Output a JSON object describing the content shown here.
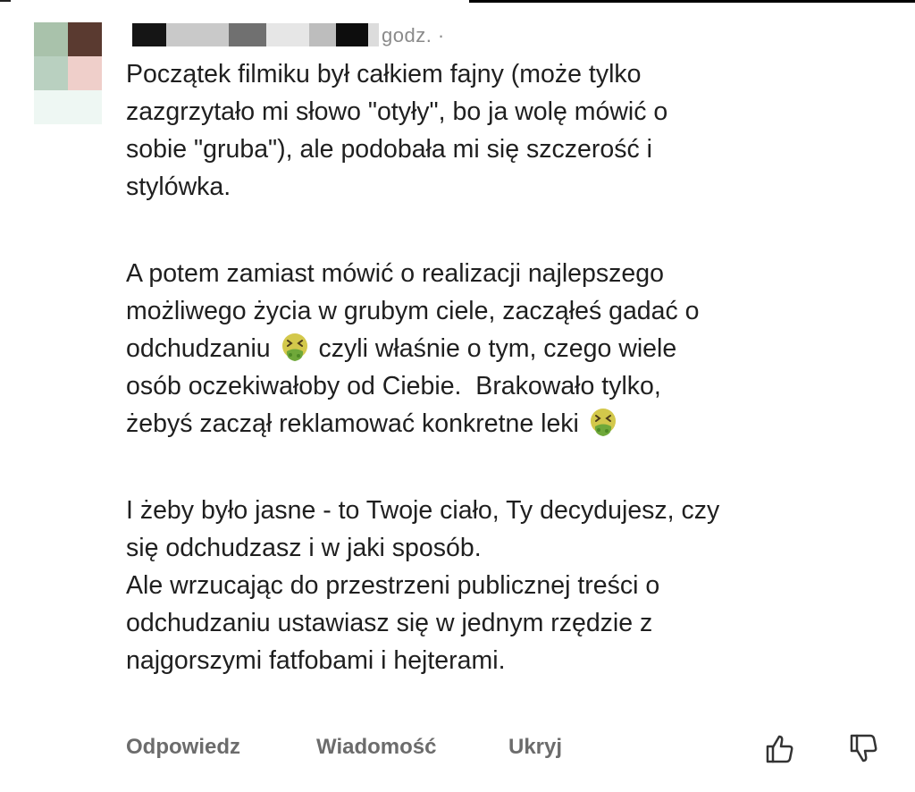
{
  "comment": {
    "time_text": "godz. ·",
    "paragraphs": [
      {
        "lines": [
          "Początek filmiku był całkiem fajny (może tylko",
          "zazgrzytało mi słowo \"otyły\", bo ja wolę mówić o",
          "sobie \"gruba\"), ale podobała mi się szczerość i",
          "stylówka."
        ]
      },
      {
        "line1": "A potem zamiast mówić o realizacji najlepszego",
        "line2": "możliwego życia w grubym ciele, zacząłeś gadać o",
        "line3a": "odchudzaniu ",
        "line3b": " czyli właśnie o tym, czego wiele",
        "line4": "osób oczekiwałoby od Ciebie.  Brakowało tylko,",
        "line5": "żebyś zaczął reklamować konkretne leki "
      },
      {
        "lines": [
          "I żeby było jasne - to Twoje ciało, Ty decydujesz, czy",
          "się odchudzasz i w jaki sposób.",
          "Ale wrzucając do przestrzeni publicznej treści o",
          "odchudzaniu ustawiasz się w jednym rzędzie z",
          "najgorszymi fatfobami i hejterami."
        ]
      }
    ],
    "emoji_icon": "nauseated-face-emoji"
  },
  "actions": {
    "reply_label": "Odpowiedz",
    "message_label": "Wiadomość",
    "hide_label": "Ukryj",
    "like_icon": "thumbs-up-icon",
    "dislike_icon": "thumbs-down-icon"
  },
  "colors": {
    "text": "#1f1f1f",
    "meta": "#8a8a8a",
    "action": "#6c6c6c"
  }
}
